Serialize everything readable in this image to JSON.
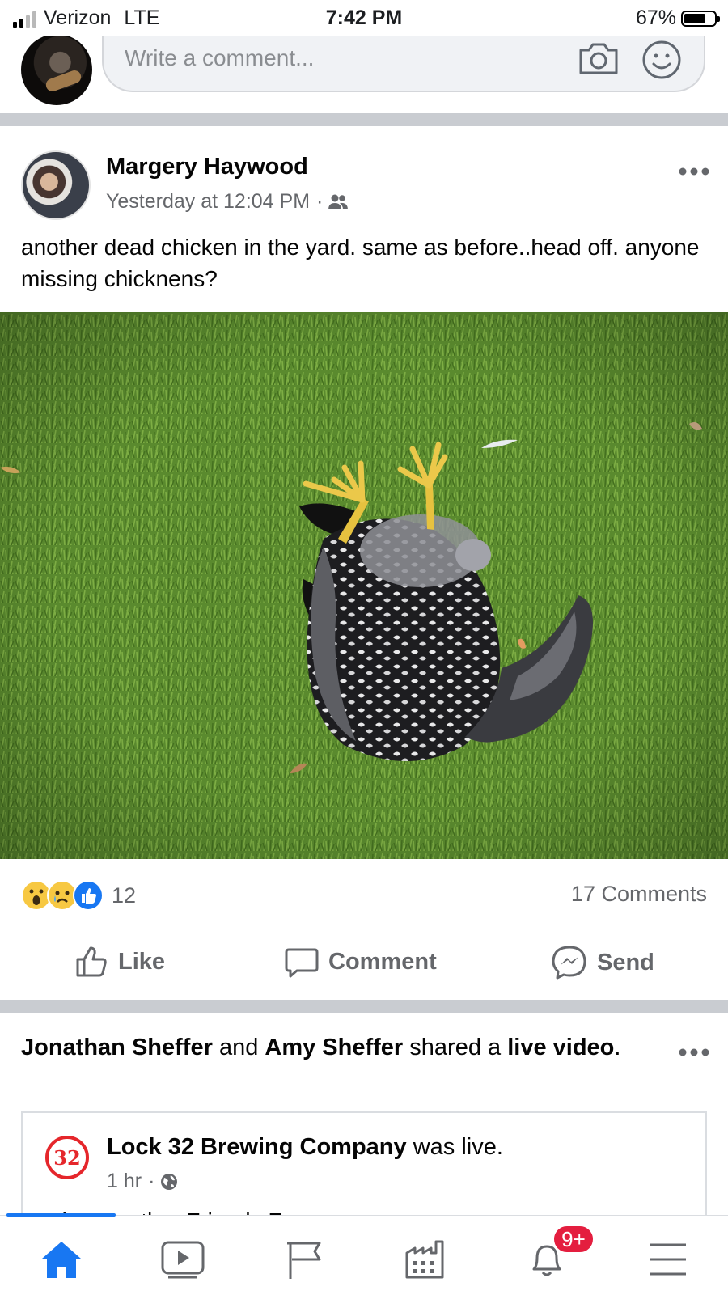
{
  "status_bar": {
    "carrier": "Verizon",
    "network": "LTE",
    "time": "7:42 PM",
    "battery": "67%"
  },
  "comment_bar": {
    "placeholder": "Write a comment..."
  },
  "post": {
    "author": "Margery Haywood",
    "timestamp": "Yesterday at 12:04 PM",
    "separator": "·",
    "audience_icon": "friends-icon",
    "text": "another dead chicken in the yard.  same as before..head off. anyone missing chicknens?",
    "reactions": [
      "wow",
      "sad",
      "like"
    ],
    "reaction_count": "12",
    "comments_count": "17 Comments",
    "actions": {
      "like": "Like",
      "comment": "Comment",
      "send": "Send"
    }
  },
  "shared_post": {
    "actor1": "Jonathan Sheffer",
    "and": "and",
    "actor2": "Amy Sheffer",
    "shared_a": "shared a",
    "object": "live video",
    "period": ".",
    "card": {
      "logo_text": "32",
      "page_name": "Lock 32 Brewing Company",
      "was_live": "was live.",
      "time": "1 hr",
      "separator": "·",
      "audience_icon": "globe-icon",
      "preview_text": "Al... Together Friends F..."
    }
  },
  "tab_bar": {
    "items": [
      "home",
      "watch",
      "pages",
      "marketplace",
      "notifications",
      "menu"
    ],
    "notifications_badge": "9+"
  },
  "colors": {
    "accent": "#1877f2",
    "badge": "#e41e3f",
    "divider": "#c9ccd1",
    "secondary_text": "#65676b"
  }
}
